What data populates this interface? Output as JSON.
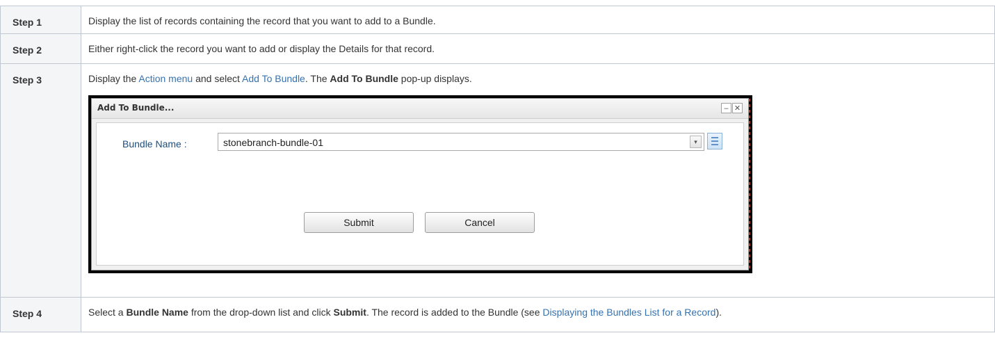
{
  "steps": [
    {
      "label": "Step 1",
      "text": "Display the list of records containing the record that you want to add to a Bundle."
    },
    {
      "label": "Step 2",
      "text": "Either right-click the record you want to add or display the Details for that record."
    },
    {
      "label": "Step 3",
      "t1": "Display the ",
      "link1": "Action menu",
      "t2": " and select ",
      "link2": "Add To Bundle",
      "t3": ". The ",
      "bold1": "Add To Bundle",
      "t4": " pop-up displays."
    },
    {
      "label": "Step 4",
      "t1": "Select a ",
      "bold1": "Bundle Name",
      "t2": " from the drop-down list and click ",
      "bold2": "Submit",
      "t3": ". The record is added to the Bundle (see ",
      "link1": "Displaying the Bundles List for a Record",
      "t4": ")."
    }
  ],
  "dialog": {
    "title": "Add To Bundle...",
    "minimize_glyph": "‒",
    "close_glyph": "✕",
    "field_label": "Bundle Name :",
    "field_value": "stonebranch-bundle-01",
    "dropdown_glyph": "▾",
    "submit_label": "Submit",
    "cancel_label": "Cancel"
  },
  "colors": {
    "link": "#3572b0",
    "header_bg": "#f4f5f7",
    "border": "#c1c7d0"
  }
}
